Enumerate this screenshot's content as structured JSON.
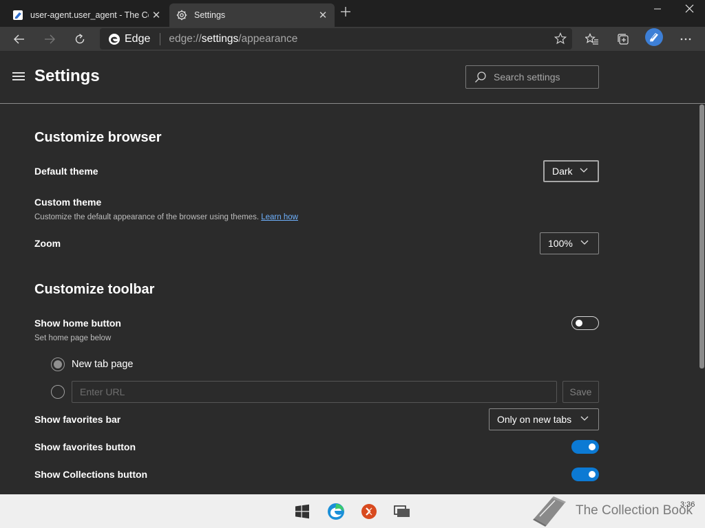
{
  "tabs": [
    {
      "title": "user-agent.user_agent - The Coll",
      "favicon": "collection-book-icon",
      "close": "✕"
    },
    {
      "title": "Settings",
      "favicon": "gear-icon",
      "close": "✕"
    }
  ],
  "window_controls": {
    "minimize": "—",
    "maximize": "☐",
    "close": "✕"
  },
  "address_bar": {
    "brand": "Edge",
    "url_scheme": "edge://",
    "url_host": "settings",
    "url_path": "/appearance"
  },
  "settings": {
    "title": "Settings",
    "search_placeholder": "Search settings"
  },
  "customize_browser": {
    "title": "Customize browser",
    "default_theme": {
      "label": "Default theme",
      "value": "Dark"
    },
    "custom_theme": {
      "label": "Custom theme",
      "desc": "Customize the default appearance of the browser using themes.",
      "link": "Learn how"
    },
    "zoom": {
      "label": "Zoom",
      "value": "100%"
    }
  },
  "customize_toolbar": {
    "title": "Customize toolbar",
    "home_button": {
      "label": "Show home button",
      "desc": "Set home page below",
      "on": false
    },
    "home_options": {
      "new_tab": "New tab page",
      "url_placeholder": "Enter URL",
      "save": "Save"
    },
    "favorites_bar": {
      "label": "Show favorites bar",
      "value": "Only on new tabs"
    },
    "favorites_button": {
      "label": "Show favorites button",
      "on": true
    },
    "collections_button": {
      "label": "Show Collections button",
      "on": true
    }
  },
  "taskbar": {
    "watermark": "The Collection Book",
    "clock": "3:36"
  },
  "colors": {
    "accent": "#0c7ad4",
    "link": "#6fb2ff",
    "background": "#2b2b2b"
  }
}
